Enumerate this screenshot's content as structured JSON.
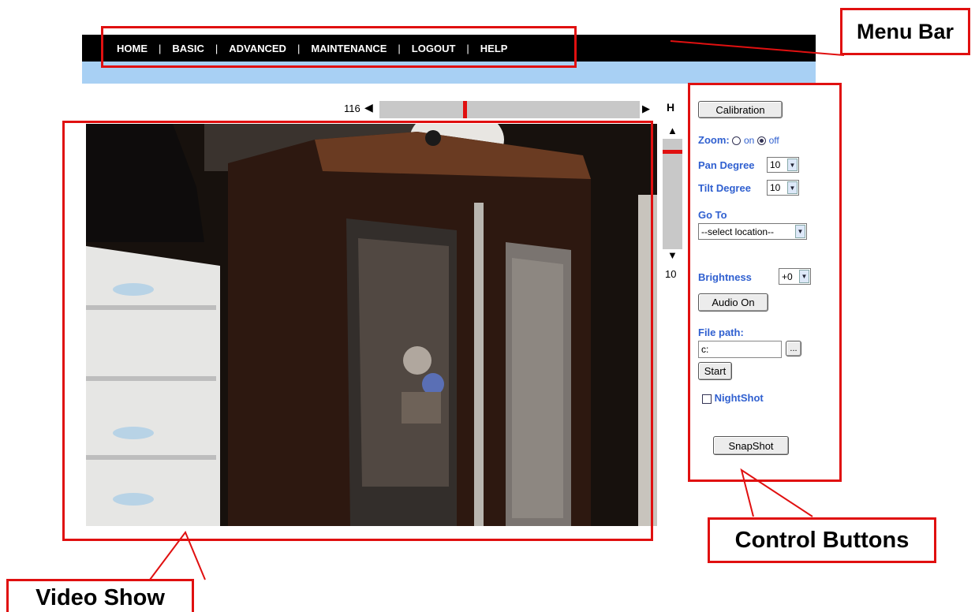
{
  "menu": {
    "items": [
      "HOME",
      "BASIC",
      "ADVANCED",
      "MAINTENANCE",
      "LOGOUT",
      "HELP"
    ],
    "separator": "|"
  },
  "pan": {
    "value": "116",
    "position_fraction": 0.32,
    "left_arrow": "◀",
    "right_arrow": "▶",
    "home_label": "H"
  },
  "tilt": {
    "value": "10",
    "position_fraction": 0.1,
    "up_arrow": "▲",
    "down_arrow": "▼"
  },
  "controls": {
    "calibration_label": "Calibration",
    "zoom_label": "Zoom:",
    "zoom_on": "on",
    "zoom_off": "off",
    "zoom_selected": "off",
    "pan_degree_label": "Pan Degree",
    "pan_degree_value": "10",
    "tilt_degree_label": "Tilt Degree",
    "tilt_degree_value": "10",
    "goto_label": "Go To",
    "goto_value": "--select location--",
    "brightness_label": "Brightness",
    "brightness_value": "+0",
    "audio_label": "Audio On",
    "file_path_label": "File path:",
    "file_path_value": "c:",
    "browse_label": "...",
    "start_label": "Start",
    "nightshot_label": "NightShot",
    "snapshot_label": "SnapShot"
  },
  "annotations": {
    "menu_bar": "Menu Bar",
    "control_buttons": "Control Buttons",
    "video_show": "Video Show"
  },
  "colors": {
    "annotation": "#e01010",
    "menu_bg": "#000000",
    "sub_bar": "#a8d0f4",
    "control_text": "#3060d0"
  }
}
